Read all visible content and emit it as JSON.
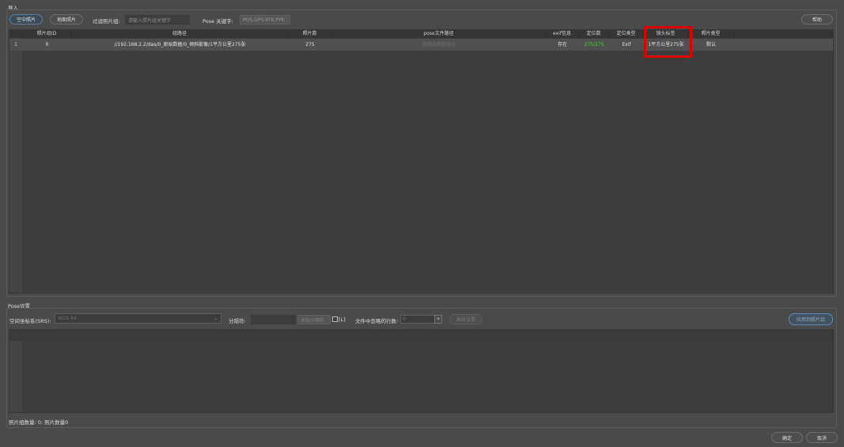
{
  "import_group": {
    "title": "导入",
    "btn_aerial": "空中照片",
    "btn_ground": "地面照片",
    "filter_label": "过滤照片组:",
    "filter_placeholder": "请输入照片组关键字",
    "pose_keyword_label": "Pose 关键字:",
    "pose_keyword_value": "POS;GPS;RTK;PPK",
    "help_label": "帮助"
  },
  "photo_table": {
    "headers": [
      "照片组ID",
      "组路径",
      "照片数",
      "pose文件路径",
      "exif信息",
      "定位数",
      "定位类型",
      "镜头标签",
      "照片类型"
    ],
    "rows": [
      {
        "row_number": "1",
        "group_id": "0",
        "group_path": "//192.168.2.2/das/0_原始数据/0_倾斜影像/1平方公里275张",
        "photo_count": "275",
        "pose_path": "双击选择新路径",
        "exif": "存在",
        "located": "275/275",
        "locate_type": "Exif",
        "lens_tag": "1平方公里275张",
        "photo_type": "默认"
      }
    ]
  },
  "pose_group": {
    "title": "Pose设置",
    "srs_label": "空间坐标系(SRS):",
    "srs_value": "WGS 84",
    "separator_label": "分隔符:",
    "separator_placeholder": "添加分隔符",
    "bracket_label": "[L]",
    "skip_rows_label": "文件中忽略的行数:",
    "skip_rows_value": "0",
    "advanced_label": "高级设置",
    "apply_label": "应用到照片组"
  },
  "status": {
    "summary": "照片组数量: 0; 照片数量0"
  },
  "footer": {
    "ok_label": "确定",
    "cancel_label": "取消"
  },
  "colors": {
    "highlight": "#e00000",
    "green_count": "#3fd13f",
    "active_btn_border": "#5a7fa6"
  }
}
